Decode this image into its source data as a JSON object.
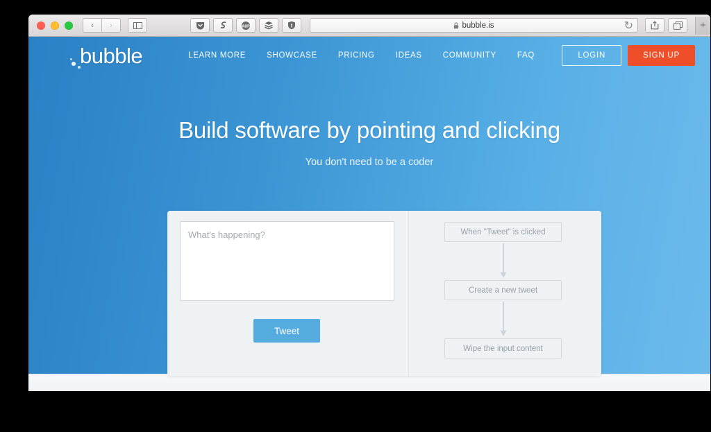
{
  "browser": {
    "window_controls": [
      {
        "name": "close",
        "color": "#ff5f57"
      },
      {
        "name": "minimize",
        "color": "#febc2e"
      },
      {
        "name": "zoom",
        "color": "#28c840"
      }
    ],
    "back_label": "‹",
    "forward_label": "›",
    "sidebar_label": "sidebar-icon",
    "extensions": [
      {
        "name": "pocket-extension-icon",
        "label": "pocket"
      },
      {
        "name": "evernote-extension-icon",
        "label": "evernote"
      },
      {
        "name": "adblock-plus-extension-icon",
        "label": "ABP"
      },
      {
        "name": "buffer-extension-icon",
        "label": "buffer"
      },
      {
        "name": "ublock-shield-extension-icon",
        "label": "ublock"
      }
    ],
    "url": "bubble.is",
    "lock_icon": "lock-icon",
    "reload_label": "↻",
    "share_label": "share-icon",
    "tabs_label": "show-tabs-icon",
    "new_tab_label": "+"
  },
  "site": {
    "logo_text": "bubble",
    "nav": [
      {
        "label": "LEARN MORE"
      },
      {
        "label": "SHOWCASE"
      },
      {
        "label": "PRICING"
      },
      {
        "label": "IDEAS"
      },
      {
        "label": "COMMUNITY"
      },
      {
        "label": "FAQ"
      }
    ],
    "login_label": "LOGIN",
    "signup_label": "SIGN UP",
    "hero": {
      "title": "Build software by pointing and clicking",
      "subtitle": "You don't need to be a coder"
    },
    "demo": {
      "tweet_placeholder": "What's happening?",
      "tweet_value": "",
      "tweet_button_label": "Tweet",
      "workflow": [
        {
          "label": "When \"Tweet\" is clicked"
        },
        {
          "label": "Create a new tweet"
        },
        {
          "label": "Wipe the input content"
        }
      ]
    }
  },
  "colors": {
    "hero_gradient_start": "#2a81c5",
    "hero_gradient_end": "#6cbaec",
    "signup_button": "#ee4f29",
    "tweet_button": "#55acdf",
    "card_background": "#eef2f4"
  }
}
